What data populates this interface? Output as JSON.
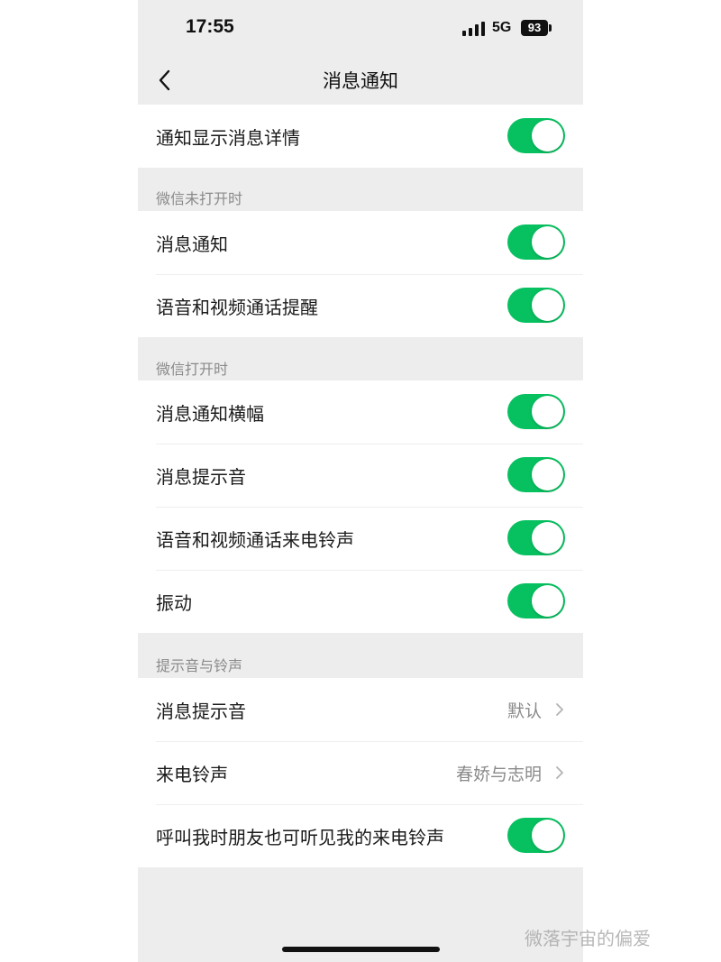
{
  "status_bar": {
    "time": "17:55",
    "network": "5G",
    "battery": "93"
  },
  "nav": {
    "title": "消息通知"
  },
  "groups": [
    {
      "header": "",
      "rows": [
        {
          "label": "通知显示消息详情",
          "on": true
        }
      ]
    },
    {
      "header": "微信未打开时",
      "rows": [
        {
          "label": "消息通知",
          "on": true
        },
        {
          "label": "语音和视频通话提醒",
          "on": true
        }
      ]
    },
    {
      "header": "微信打开时",
      "rows": [
        {
          "label": "消息通知横幅",
          "on": true
        },
        {
          "label": "消息提示音",
          "on": true
        },
        {
          "label": "语音和视频通话来电铃声",
          "on": true
        },
        {
          "label": "振动",
          "on": true
        }
      ]
    },
    {
      "header": "提示音与铃声",
      "rows": [
        {
          "label": "消息提示音",
          "value": "默认"
        },
        {
          "label": "来电铃声",
          "value": "春娇与志明"
        },
        {
          "label": "呼叫我时朋友也可听见我的来电铃声",
          "on": true
        }
      ]
    }
  ],
  "colors": {
    "toggle_on": "#07c160",
    "background": "#ededed"
  },
  "icons": {
    "back": "chevron-left-icon",
    "detail": "chevron-right-icon",
    "signal": "signal-icon",
    "battery": "battery-icon"
  },
  "watermark": "微落宇宙的偏爱"
}
